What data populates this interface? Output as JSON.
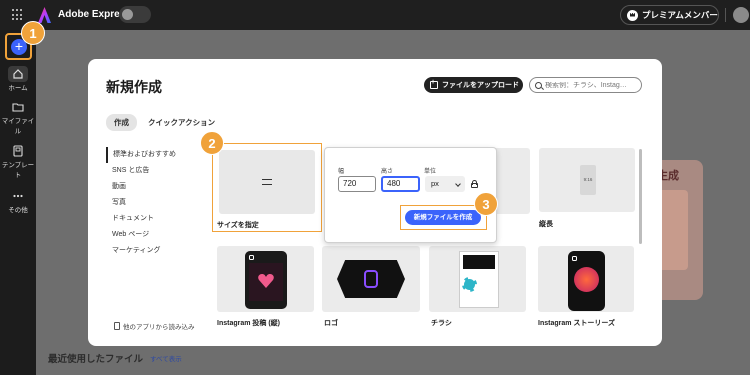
{
  "app": {
    "name": "Adobe Express",
    "premium_label": "プレミアムメンバー"
  },
  "sidebar": {
    "create_symbol": "+",
    "items": [
      {
        "label": "ホーム",
        "icon": "home-icon"
      },
      {
        "label": "マイファイル",
        "icon": "folder-icon"
      },
      {
        "label": "テンプレート",
        "icon": "template-icon"
      },
      {
        "label": "その他",
        "icon": "more-icon"
      }
    ]
  },
  "background": {
    "recent_files": "最近使用したファイル",
    "show_all": "すべて表示",
    "card_partial_text": "生成"
  },
  "modal": {
    "title": "新規作成",
    "upload_label": "ファイルをアップロード",
    "search_placeholder": "検索例：チラシ、Instag…",
    "tabs": [
      "作成",
      "クイックアクション"
    ],
    "categories": [
      "標準およびおすすめ",
      "SNS と広告",
      "動画",
      "写真",
      "ドキュメント",
      "Web ページ",
      "マーケティング"
    ],
    "other_apps": "他のアプリから読み込み",
    "cards": {
      "custom_size": "サイズを指定",
      "portrait": "縦長",
      "portrait_ratio": "9:16",
      "instagram_post": "Instagram 投稿 (縦)",
      "logo": "ロゴ",
      "flyer": "チラシ",
      "instagram_story": "Instagram ストーリーズ"
    },
    "popover": {
      "width_label": "幅",
      "height_label": "高さ",
      "unit_label": "単位",
      "width_value": "720",
      "height_value": "480",
      "unit_value": "px",
      "create_button": "新規ファイルを作成"
    }
  },
  "steps": [
    "1",
    "2",
    "3"
  ],
  "colors": {
    "accent_orange": "#f0a23a",
    "primary_blue": "#3b63fb",
    "topbar": "#1f1f1f"
  }
}
